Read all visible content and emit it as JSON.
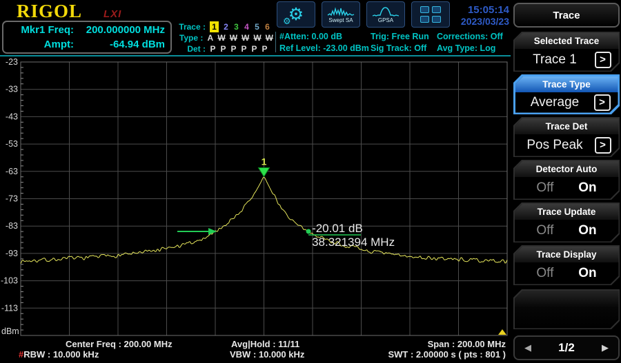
{
  "brand": {
    "logo": "RIGOL",
    "lxi": "LXI"
  },
  "header": {
    "marker_readout": {
      "row1_label": "Mkr1 Freq:",
      "row1_value": "200.000000 MHz",
      "row2_label": "Ampt:",
      "row2_value": "-64.94 dBm"
    },
    "trace_legend": {
      "trace_label": "Trace :",
      "type_label": "Type :",
      "det_label": "Det :",
      "trace_nums": [
        "1",
        "2",
        "3",
        "4",
        "5",
        "6"
      ],
      "type_vals": [
        "A",
        "W",
        "W",
        "W",
        "W",
        "W"
      ],
      "det_vals": [
        "P",
        "P",
        "P",
        "P",
        "P",
        "P"
      ]
    },
    "toolbar": {
      "swept_sa_label": "Swept SA",
      "gpsa_label": "GPSA"
    },
    "status": {
      "col1": [
        "#Atten: 0.00 dB",
        "Ref Level: -23.00 dBm"
      ],
      "col2": [
        "Trig: Free Run",
        "Sig Track: Off"
      ],
      "col3": [
        "Corrections: Off",
        "Avg Type: Log"
      ]
    },
    "clock": {
      "time": "15:05:14",
      "date": "2023/03/23"
    }
  },
  "chart_data": {
    "type": "line",
    "title": "",
    "xlabel": "",
    "ylabel": "dBm",
    "x_axis": {
      "start_mhz": 100,
      "stop_mhz": 300,
      "center_mhz": 200,
      "span_mhz": 200,
      "divisions": 10
    },
    "y_axis": {
      "unit": "dBm",
      "ref_level_dbm": -23,
      "scale_db_per_div": 10,
      "divisions": 10,
      "tick_labels": [
        "-23",
        "-33",
        "-43",
        "-53",
        "-63",
        "-73",
        "-83",
        "-93",
        "-103",
        "-113"
      ],
      "ylim": [
        -123,
        -23
      ]
    },
    "grid": true,
    "series": [
      {
        "name": "Trace 1 Average",
        "color": "#e6e65c",
        "noise_db": 0.9,
        "anchor_points_mhz_dbm": [
          [
            100,
            -95.8
          ],
          [
            112,
            -95.3
          ],
          [
            124,
            -94.7
          ],
          [
            136,
            -93.9
          ],
          [
            148,
            -92.9
          ],
          [
            157,
            -91.8
          ],
          [
            164,
            -90.6
          ],
          [
            170,
            -89.2
          ],
          [
            175,
            -87.6
          ],
          [
            180,
            -85.0
          ],
          [
            184,
            -82.6
          ],
          [
            187,
            -80.4
          ],
          [
            190,
            -78.0
          ],
          [
            192.5,
            -75.6
          ],
          [
            194.5,
            -73.2
          ],
          [
            196.5,
            -70.6
          ],
          [
            198,
            -68.2
          ],
          [
            199,
            -66.5
          ],
          [
            199.6,
            -65.4
          ],
          [
            200,
            -64.94
          ],
          [
            200.5,
            -65.6
          ],
          [
            201.2,
            -67.0
          ],
          [
            202.5,
            -69.2
          ],
          [
            204,
            -71.6
          ],
          [
            206,
            -74.6
          ],
          [
            208.5,
            -77.8
          ],
          [
            211,
            -80.6
          ],
          [
            214,
            -83.0
          ],
          [
            218.3,
            -84.95
          ],
          [
            222,
            -86.6
          ],
          [
            227,
            -88.4
          ],
          [
            233,
            -90.0
          ],
          [
            240,
            -91.6
          ],
          [
            248,
            -92.9
          ],
          [
            258,
            -94.0
          ],
          [
            270,
            -94.8
          ],
          [
            283,
            -95.4
          ],
          [
            300,
            -95.9
          ]
        ]
      }
    ],
    "markers": [
      {
        "id": "1",
        "freq_mhz": 200,
        "ampl_dbm": -64.94,
        "shape": "triangle-down",
        "color": "#2ce04a",
        "label_color": "#d8e850"
      }
    ],
    "measurement": {
      "label_db": "-20.01 dB",
      "label_freq": "38.321394 MHz",
      "left_freq_mhz": 180.0,
      "right_freq_mhz": 218.32,
      "level_dbm": -84.95,
      "color": "#22cc55",
      "text_color": "#e8e8e8"
    },
    "offscreen_indicator": {
      "shape": "triangle-up",
      "color": "#e8d020"
    }
  },
  "footer": {
    "center_freq": "Center Freq : 200.00 MHz",
    "rbw_hash": "#",
    "rbw": "RBW : 10.000 kHz",
    "avg_hold": "Avg|Hold : 11/11",
    "vbw": "VBW : 10.000 kHz",
    "span": "Span : 200.00 MHz",
    "swt": "SWT : 2.00000 s ( pts : 801 )"
  },
  "panel": {
    "title": "Trace",
    "groups": [
      {
        "header": "Selected Trace",
        "type": "value",
        "value": "Trace 1"
      },
      {
        "header": "Trace Type",
        "type": "value",
        "value": "Average",
        "highlighted": true
      },
      {
        "header": "Trace Det",
        "type": "value",
        "value": "Pos Peak"
      },
      {
        "header": "Detector Auto",
        "type": "toggle",
        "off": "Off",
        "on": "On",
        "selected": "On"
      },
      {
        "header": "Trace Update",
        "type": "toggle",
        "off": "Off",
        "on": "On",
        "selected": "On"
      },
      {
        "header": "Trace Display",
        "type": "toggle",
        "off": "Off",
        "on": "On",
        "selected": "On"
      }
    ],
    "pager": {
      "prev": "◀",
      "label": "1/2",
      "next": "▶"
    }
  },
  "icons": {
    "gear": "⚙",
    "chevron": ">"
  },
  "colors": {
    "accent_cyan": "#00d4d4",
    "clock_blue": "#2e5bc8",
    "trace_yellow": "#e6e65c",
    "marker_green": "#2ce04a",
    "highlight_blue": "#4aa0f0",
    "logo_yellow": "#f2d90a",
    "lxi_red": "#9b1b1b",
    "rbw_hash_red": "#e03030",
    "grid_gray": "#4c4c4c"
  }
}
